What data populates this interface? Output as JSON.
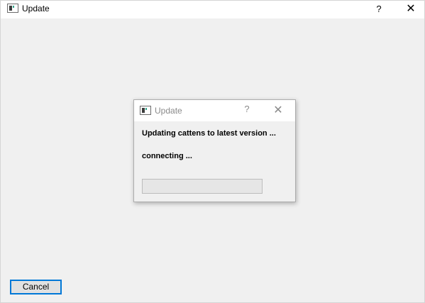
{
  "window": {
    "title": "Update",
    "help_glyph": "?",
    "close_glyph": "✕",
    "icon": "app-window-icon"
  },
  "dialog": {
    "title": "Update",
    "help_glyph": "?",
    "close_glyph": "✕",
    "icon": "app-window-icon",
    "message": "Updating cattens to latest version ...",
    "status": "connecting ...",
    "progress": 0,
    "progress_color": "#06b025"
  },
  "footer": {
    "cancel_label": "Cancel"
  },
  "colors": {
    "accent": "#0078d7",
    "background": "#f0f0f0"
  }
}
